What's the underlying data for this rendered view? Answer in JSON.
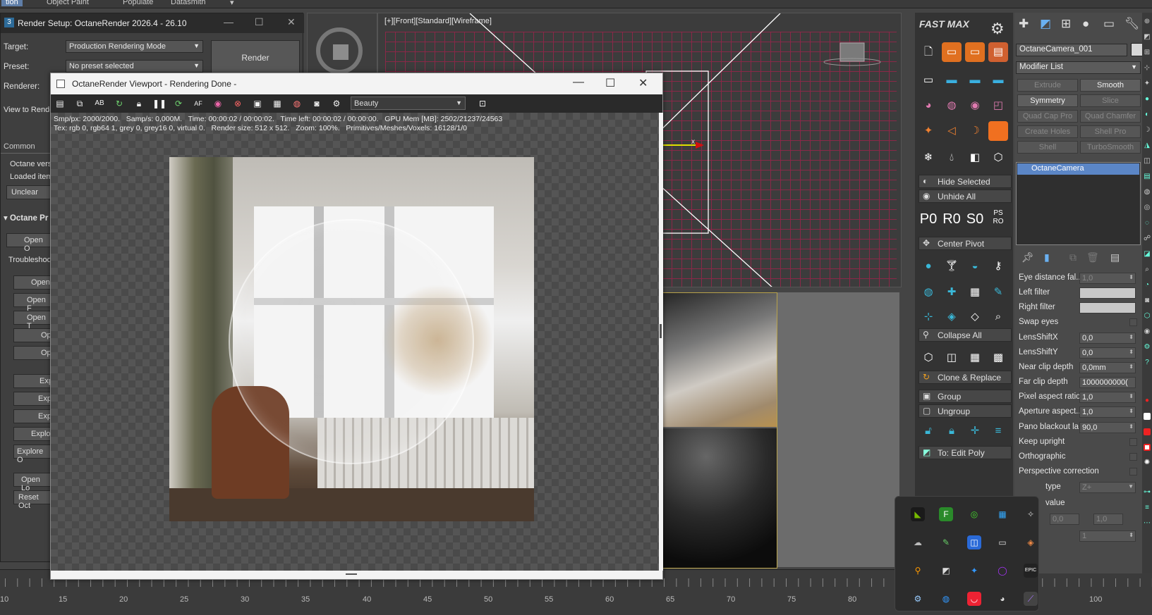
{
  "menu": [
    "tion",
    "Object Paint",
    "Populate",
    "Datasmith",
    "▾"
  ],
  "viewport_front": {
    "label": "[+][Front][Standard][Wireframe]",
    "axis_label": "x"
  },
  "render_setup": {
    "title": "Render Setup: OctaneRender 2026.4 - 26.10",
    "target_label": "Target:",
    "target_value": "Production Rendering Mode",
    "preset_label": "Preset:",
    "preset_value": "No preset selected",
    "renderer_label": "Renderer:",
    "view_label": "View to Rende",
    "render_button": "Render",
    "tab_common": "Common",
    "rows": [
      "Octane vers",
      "Loaded item",
      "Unclear",
      "Octane Pr",
      "Open O",
      "Troubleshoot",
      "Open",
      "Open F",
      "Open T",
      "Op",
      "Op",
      "Exp",
      "Exp",
      "Exp",
      "Explo",
      "Explore O",
      "Open Lo",
      "Reset Oct"
    ]
  },
  "octane_viewport": {
    "title": "OctaneRender Viewport - Rendering Done -",
    "channel": "Beauty",
    "stats_line1": "Smp/px: 2000/2000.   Samp/s: 0,000M.   Time: 00:00:02 / 00:00:02.   Time left: 00:00:02 / 00:00:00.   GPU Mem [MB]: 2502/21237/24563",
    "stats_line2": "Tex: rgb 0, rgb64 1, grey 0, grey16 0, virtual 0.   Render size: 512 x 512.   Zoom: 100%.   Primitives/Meshes/Voxels: 16128/1/0",
    "toolbar_icons": [
      "save-render-icon",
      "copy-icon",
      "ab-compare-icon",
      "refresh-icon",
      "lock-icon",
      "pause-icon",
      "restart-icon",
      "aperture-icon",
      "color-picker-icon",
      "focus-icon",
      "region-icon",
      "film-icon",
      "clay-icon",
      "camera-icon",
      "settings-icon"
    ]
  },
  "fastmax": {
    "logo": "FAST MAX",
    "buttons": {
      "hide_selected": "Hide Selected",
      "unhide_all": "Unhide All",
      "center_pivot": "Center Pivot",
      "collapse_all": "Collapse All",
      "clone_replace": "Clone & Replace",
      "group": "Group",
      "ungroup": "Ungroup",
      "to_edit_poly": "To: Edit Poly"
    },
    "pros": [
      "P0",
      "R0",
      "S0",
      "PS RO"
    ]
  },
  "modify_panel": {
    "object_name": "OctaneCamera_001",
    "modifier_list": "Modifier List",
    "buttons": [
      "Extrude",
      "Smooth",
      "Symmetry",
      "Slice",
      "Quad Cap Pro",
      "Quad Chamfer",
      "Create Holes",
      "Shell Pro",
      "Shell",
      "TurboSmooth"
    ],
    "stack_item": "OctaneCamera",
    "params": [
      {
        "label": "Eye distance fal...",
        "value": "1,0"
      },
      {
        "label": "Left filter",
        "value": ""
      },
      {
        "label": "Right filter",
        "value": ""
      },
      {
        "label": "Swap eyes",
        "value": ""
      },
      {
        "label": "LensShiftX",
        "value": "0,0"
      },
      {
        "label": "LensShiftY",
        "value": "0,0"
      },
      {
        "label": "Near clip depth",
        "value": "0,0mm"
      },
      {
        "label": "Far clip depth",
        "value": "1000000000("
      },
      {
        "label": "Pixel aspect ratio",
        "value": "1,0"
      },
      {
        "label": "Aperture aspect...",
        "value": "1,0"
      },
      {
        "label": "Pano blackout la...",
        "value": "90,0"
      },
      {
        "label": "Keep upright",
        "value": ""
      },
      {
        "label": "Orthographic",
        "value": ""
      },
      {
        "label": "Perspective correction",
        "value": ""
      },
      {
        "label": "type",
        "value": "Z+"
      },
      {
        "label": "value",
        "value": ""
      }
    ],
    "extra_values": [
      "0,0",
      "1,0",
      "1"
    ]
  },
  "timeline": {
    "labels": [
      "10",
      "15",
      "20",
      "25",
      "30",
      "35",
      "40",
      "45",
      "50",
      "55",
      "60",
      "65",
      "70",
      "75",
      "80",
      "100"
    ]
  },
  "tray_icons": [
    "nvidia-icon",
    "f-app-icon",
    "razer-icon",
    "microsoft-store-icon",
    "app-icon",
    "cloud-icon",
    "pen-icon",
    "app-icon",
    "tablet-icon",
    "copilot-icon",
    "search-icon",
    "app-icon",
    "star-icon",
    "circle-icon",
    "epic-icon",
    "steam-icon",
    "app-icon",
    "app-icon",
    "discord-icon",
    "feather-icon"
  ]
}
